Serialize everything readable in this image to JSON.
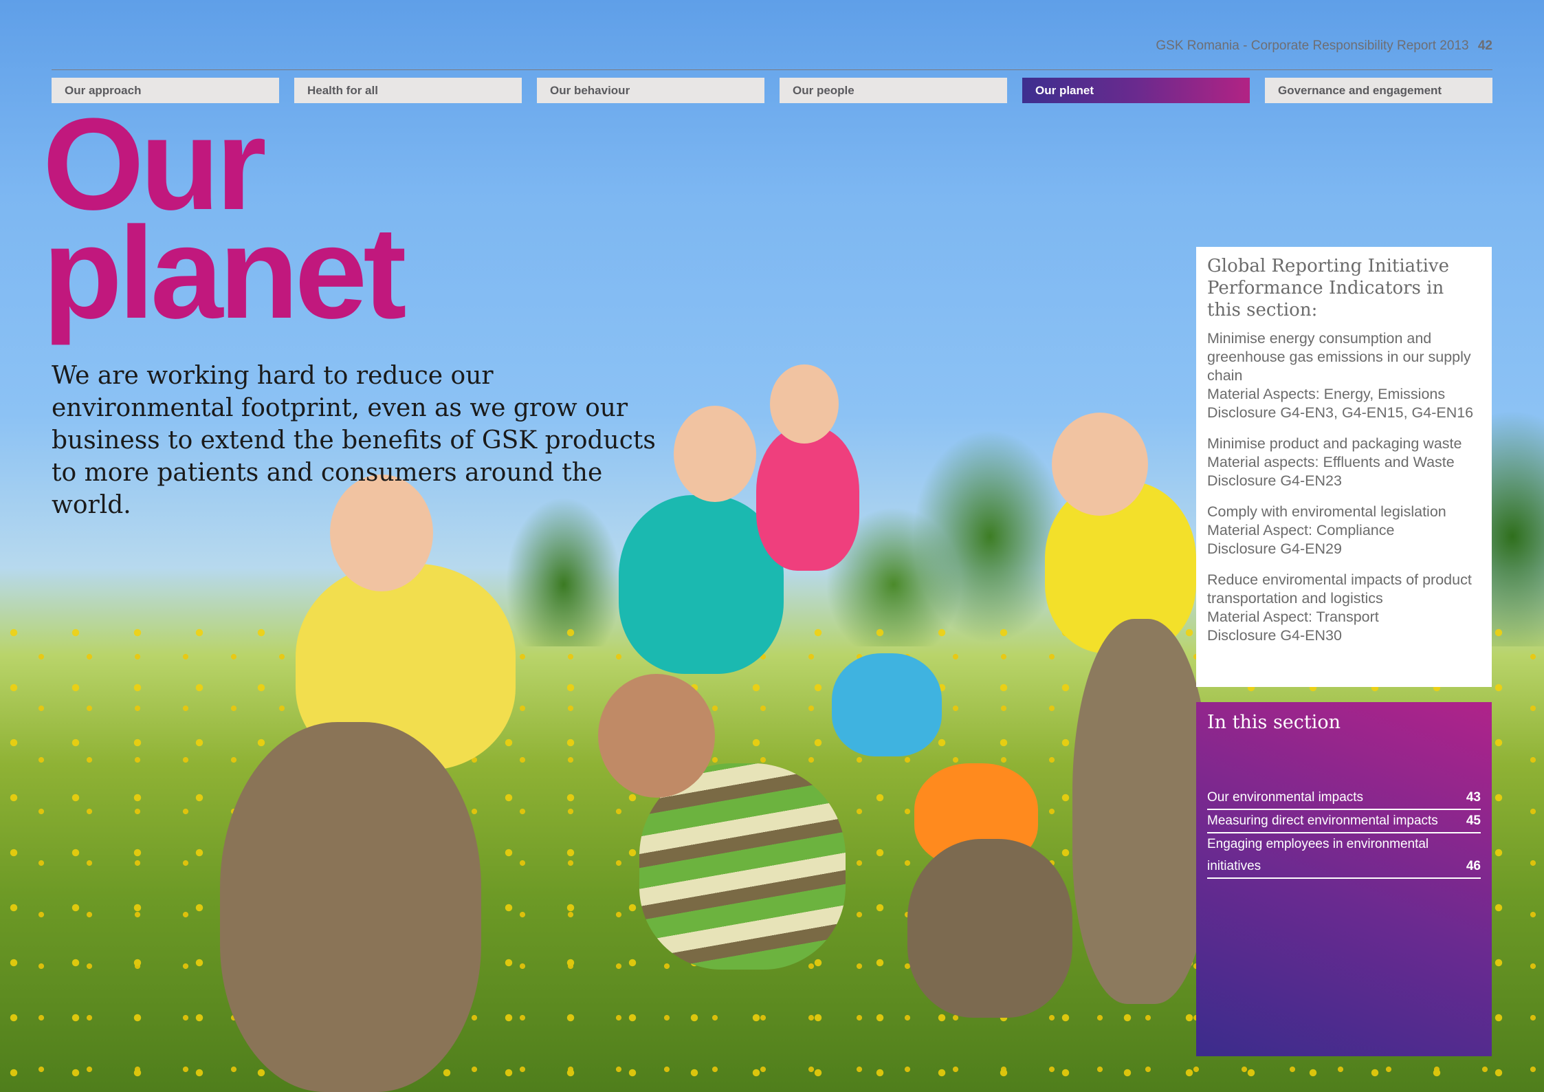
{
  "header": {
    "report_title": "GSK Romania - Corporate Responsibility Report 2013",
    "page_number": "42"
  },
  "nav": {
    "items": [
      {
        "label": "Our approach",
        "active": false
      },
      {
        "label": "Health for all",
        "active": false
      },
      {
        "label": "Our behaviour",
        "active": false
      },
      {
        "label": "Our people",
        "active": false
      },
      {
        "label": "Our planet",
        "active": true
      },
      {
        "label": "Governance and engagement",
        "active": false
      }
    ]
  },
  "hero": {
    "title_line1": "Our",
    "title_line2": "planet",
    "intro": "We are working hard to reduce our environmental footprint, even as we grow our business to extend the benefits of GSK products to more patients and consumers around the world."
  },
  "gri": {
    "heading": "Global Reporting Initiative Performance Indicators in this section:",
    "items": [
      {
        "title": "Minimise energy consumption and greenhouse gas emissions in our supply chain",
        "aspect": "Material Aspects: Energy, Emissions",
        "disclosure": "Disclosure G4-EN3, G4-EN15, G4-EN16"
      },
      {
        "title": "Minimise product and packaging waste",
        "aspect": "Material aspects: Effluents and Waste",
        "disclosure": "Disclosure G4-EN23"
      },
      {
        "title": "Comply with enviromental legislation",
        "aspect": "Material Aspect: Compliance",
        "disclosure": "Disclosure G4-EN29"
      },
      {
        "title": "Reduce enviromental impacts of product transportation and logistics",
        "aspect": "Material Aspect: Transport",
        "disclosure": "Disclosure G4-EN30"
      }
    ]
  },
  "in_this_section": {
    "heading": "In this section",
    "entries": [
      {
        "label": "Our environmental impacts",
        "page": "43"
      },
      {
        "label": "Measuring direct environmental impacts",
        "page": "45"
      },
      {
        "label": "Engaging employees in environmental initiatives",
        "page": "46"
      }
    ]
  },
  "colors": {
    "accent_magenta": "#c1187d",
    "nav_active_start": "#3d2f8f",
    "nav_active_end": "#b22384",
    "nav_inactive_bg": "#e8e6e5"
  }
}
